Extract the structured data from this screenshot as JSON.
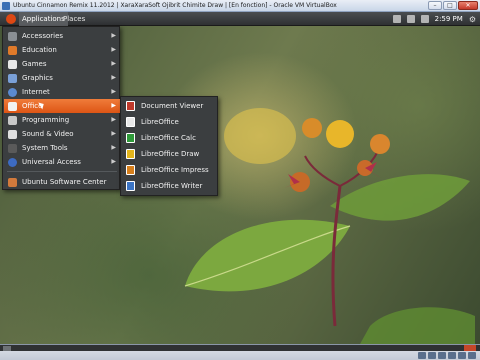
{
  "window": {
    "title": "Ubuntu Cinnamon Remix 11.2012 | XaraXaraSoft Ojibrit Chimite Draw | [En fonction] - Oracle VM VirtualBox",
    "controls": [
      "minimize",
      "maximize",
      "close"
    ]
  },
  "panel": {
    "applications_label": "Applications",
    "places_label": "Places",
    "clock": "2:59 PM",
    "tray_icons": [
      "network-icon",
      "volume-icon",
      "user-icon"
    ]
  },
  "app_menu": {
    "items": [
      {
        "label": "Accessories",
        "icon": "accessories-icon",
        "color": "#8a8f94"
      },
      {
        "label": "Education",
        "icon": "education-icon",
        "color": "#e07a2a"
      },
      {
        "label": "Games",
        "icon": "games-icon",
        "color": "#e8e8e8"
      },
      {
        "label": "Graphics",
        "icon": "graphics-icon",
        "color": "#7aa0d8"
      },
      {
        "label": "Internet",
        "icon": "internet-icon",
        "color": "#5b8ad0"
      },
      {
        "label": "Office",
        "icon": "office-icon",
        "color": "#f2f2f2"
      },
      {
        "label": "Programming",
        "icon": "programming-icon",
        "color": "#c8c8c8"
      },
      {
        "label": "Sound & Video",
        "icon": "sound-video-icon",
        "color": "#e0e0e0"
      },
      {
        "label": "System Tools",
        "icon": "system-tools-icon",
        "color": "#5a5a5a"
      },
      {
        "label": "Universal Access",
        "icon": "universal-access-icon",
        "color": "#3d6bc2"
      }
    ],
    "footer_item": {
      "label": "Ubuntu Software Center",
      "icon": "software-center-icon",
      "color": "#d27a3c"
    }
  },
  "office_submenu": {
    "items": [
      {
        "label": "Document Viewer",
        "icon": "document-viewer-icon",
        "color": "#c0392b"
      },
      {
        "label": "LibreOffice",
        "icon": "libreoffice-icon",
        "color": "#e8e8e8"
      },
      {
        "label": "LibreOffice Calc",
        "icon": "libreoffice-calc-icon",
        "color": "#2f9a3a"
      },
      {
        "label": "LibreOffice Draw",
        "icon": "libreoffice-draw-icon",
        "color": "#e3b51c"
      },
      {
        "label": "LibreOffice Impress",
        "icon": "libreoffice-impress-icon",
        "color": "#d67f1c"
      },
      {
        "label": "LibreOffice Writer",
        "icon": "libreoffice-writer-icon",
        "color": "#3b74c4"
      }
    ]
  },
  "colors": {
    "menu_highlight": "#f07c3a",
    "menu_bg": "#3b3e40"
  }
}
